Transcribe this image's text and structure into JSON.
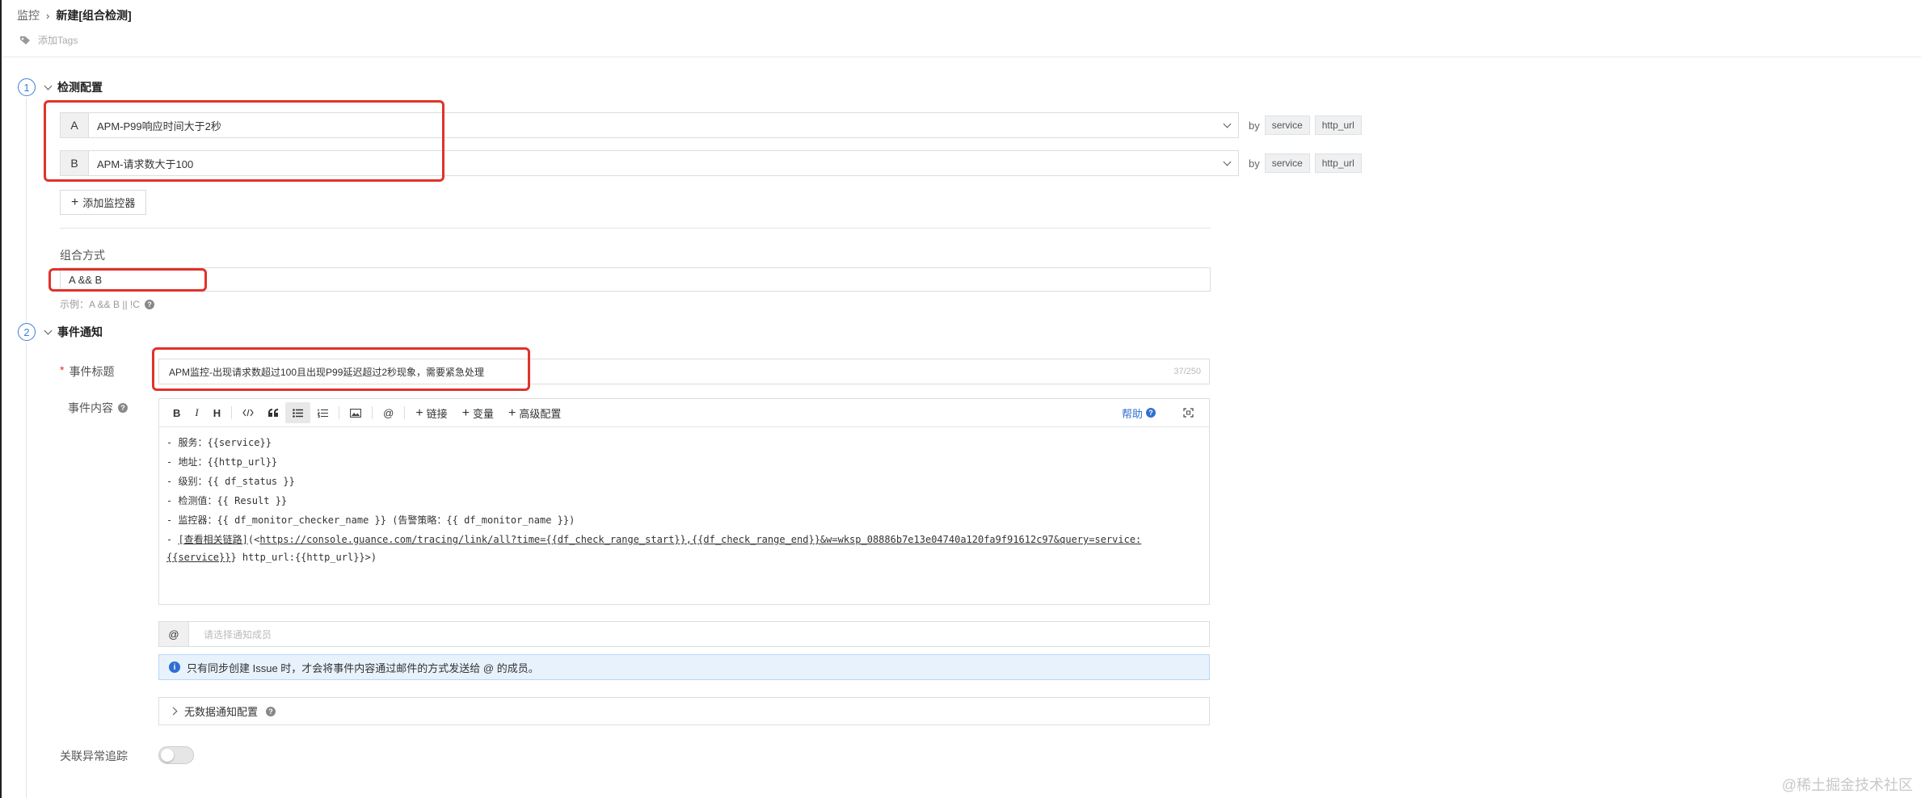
{
  "breadcrumb": {
    "parent": "监控",
    "current": "新建[组合检测]"
  },
  "tags": {
    "add_label": "添加Tags"
  },
  "section1": {
    "number": "1",
    "title": "检测配置"
  },
  "monitors": [
    {
      "letter": "A",
      "name": "APM-P99响应时间大于2秒",
      "by": "by",
      "group_tags": [
        "service",
        "http_url"
      ]
    },
    {
      "letter": "B",
      "name": "APM-请求数大于100",
      "by": "by",
      "group_tags": [
        "service",
        "http_url"
      ]
    }
  ],
  "add_monitor": {
    "label": "添加监控器"
  },
  "combine": {
    "label": "组合方式",
    "value": "A && B",
    "hint": "示例：A && B || !C"
  },
  "section2": {
    "number": "2",
    "title": "事件通知"
  },
  "event_title": {
    "required_mark": "*",
    "label": "事件标题",
    "value": "APM监控-出现请求数超过100且出现P99延迟超过2秒现象，需要紧急处理",
    "counter": "37/250"
  },
  "event_content": {
    "label": "事件内容",
    "toolbar": {
      "bold": "B",
      "italic": "I",
      "heading": "H",
      "link": "链接",
      "variable": "变量",
      "advanced": "高级配置",
      "help": "帮助"
    },
    "lines": {
      "l1": "- 服务：{{service}}",
      "l2": "- 地址：{{http_url}}",
      "l3": "- 级别：{{ df_status }}",
      "l4": "- 检测值：{{ Result }}",
      "l5": "- 监控器：{{ df_monitor_checker_name }} (告警策略：{{ df_monitor_name }})",
      "l6_prefix": "- ",
      "l6_link": "[查看相关链路]",
      "l6_open": "(<",
      "l6_url": "https://console.guance.com/tracing/link/all?time={{df_check_range_start}},{{df_check_range_end}}&w=wksp_08886b7e13e04740a120fa9f91612c97&query=service:",
      "l7_var": "{{service}}",
      "l7_rest": "} http_url:{{http_url}}>)"
    }
  },
  "mention": {
    "symbol": "@",
    "placeholder": "请选择通知成员"
  },
  "notice": {
    "text": "只有同步创建 Issue 时，才会将事件内容通过邮件的方式发送给 @ 的成员。"
  },
  "no_data": {
    "label": "无数据通知配置"
  },
  "trace": {
    "label": "关联异常追踪",
    "enabled": false
  },
  "watermark": "@稀土掘金技术社区",
  "colors": {
    "accent": "#3b7ddd",
    "highlight": "#e0332a",
    "notice_bg": "#e8f2fd"
  }
}
